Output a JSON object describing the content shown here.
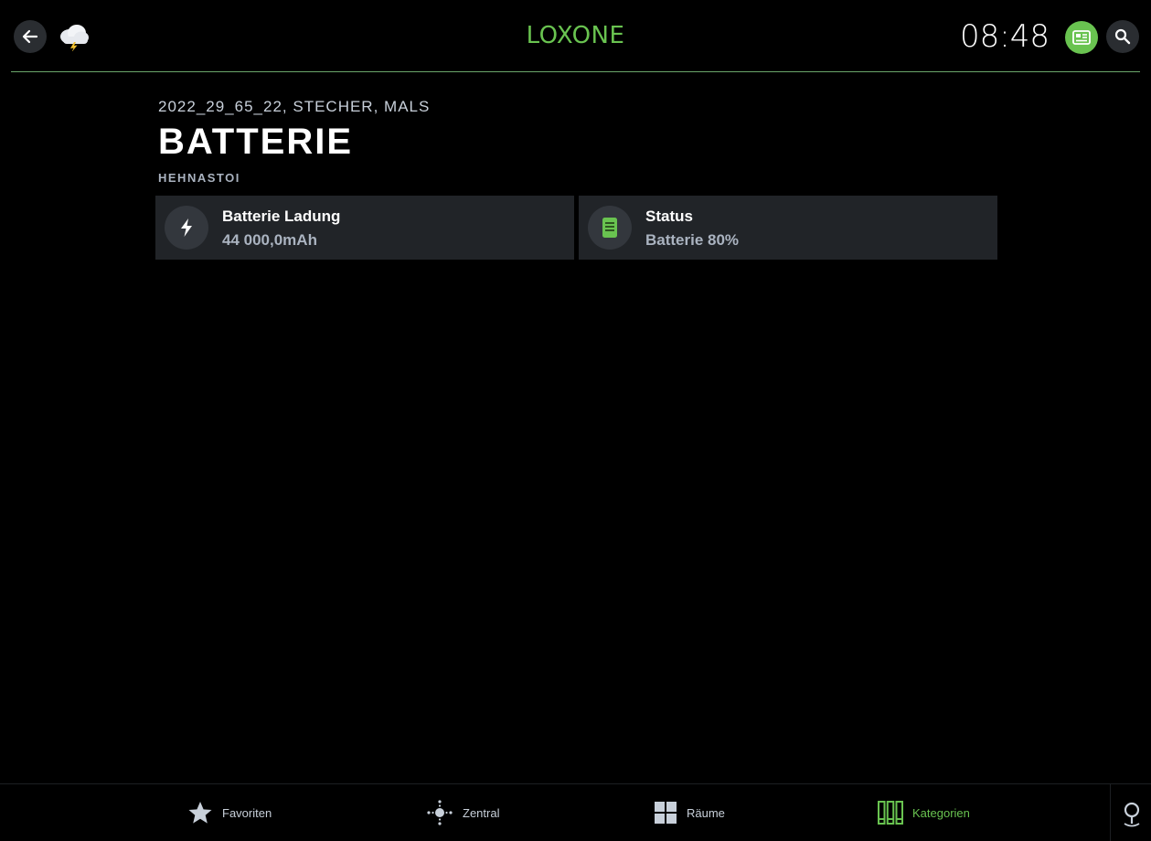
{
  "header": {
    "logo": "LOXONE",
    "time": "08:48",
    "icons": {
      "back": "back-arrow-icon",
      "weather": "thunderstorm-cloud-icon",
      "news": "news-icon",
      "search": "search-icon"
    }
  },
  "page": {
    "breadcrumb": "2022_29_65_22, STECHER, MALS",
    "title": "BATTERIE",
    "subtitle": "HEHNASTOI"
  },
  "cards": [
    {
      "title": "Batterie Ladung",
      "value": "44 000,0mAh",
      "icon": "lightning-icon"
    },
    {
      "title": "Status",
      "value": "Batterie 80%",
      "icon": "battery-icon",
      "level_percent": 80
    }
  ],
  "nav": {
    "favoriten": "Favoriten",
    "zentral": "Zentral",
    "raeume": "Räume",
    "kategorien": "Kategorien",
    "active": "kategorien"
  },
  "colors": {
    "accent": "#69c350",
    "background": "#000000",
    "card": "#212428",
    "muted_text": "#aab3c0"
  }
}
